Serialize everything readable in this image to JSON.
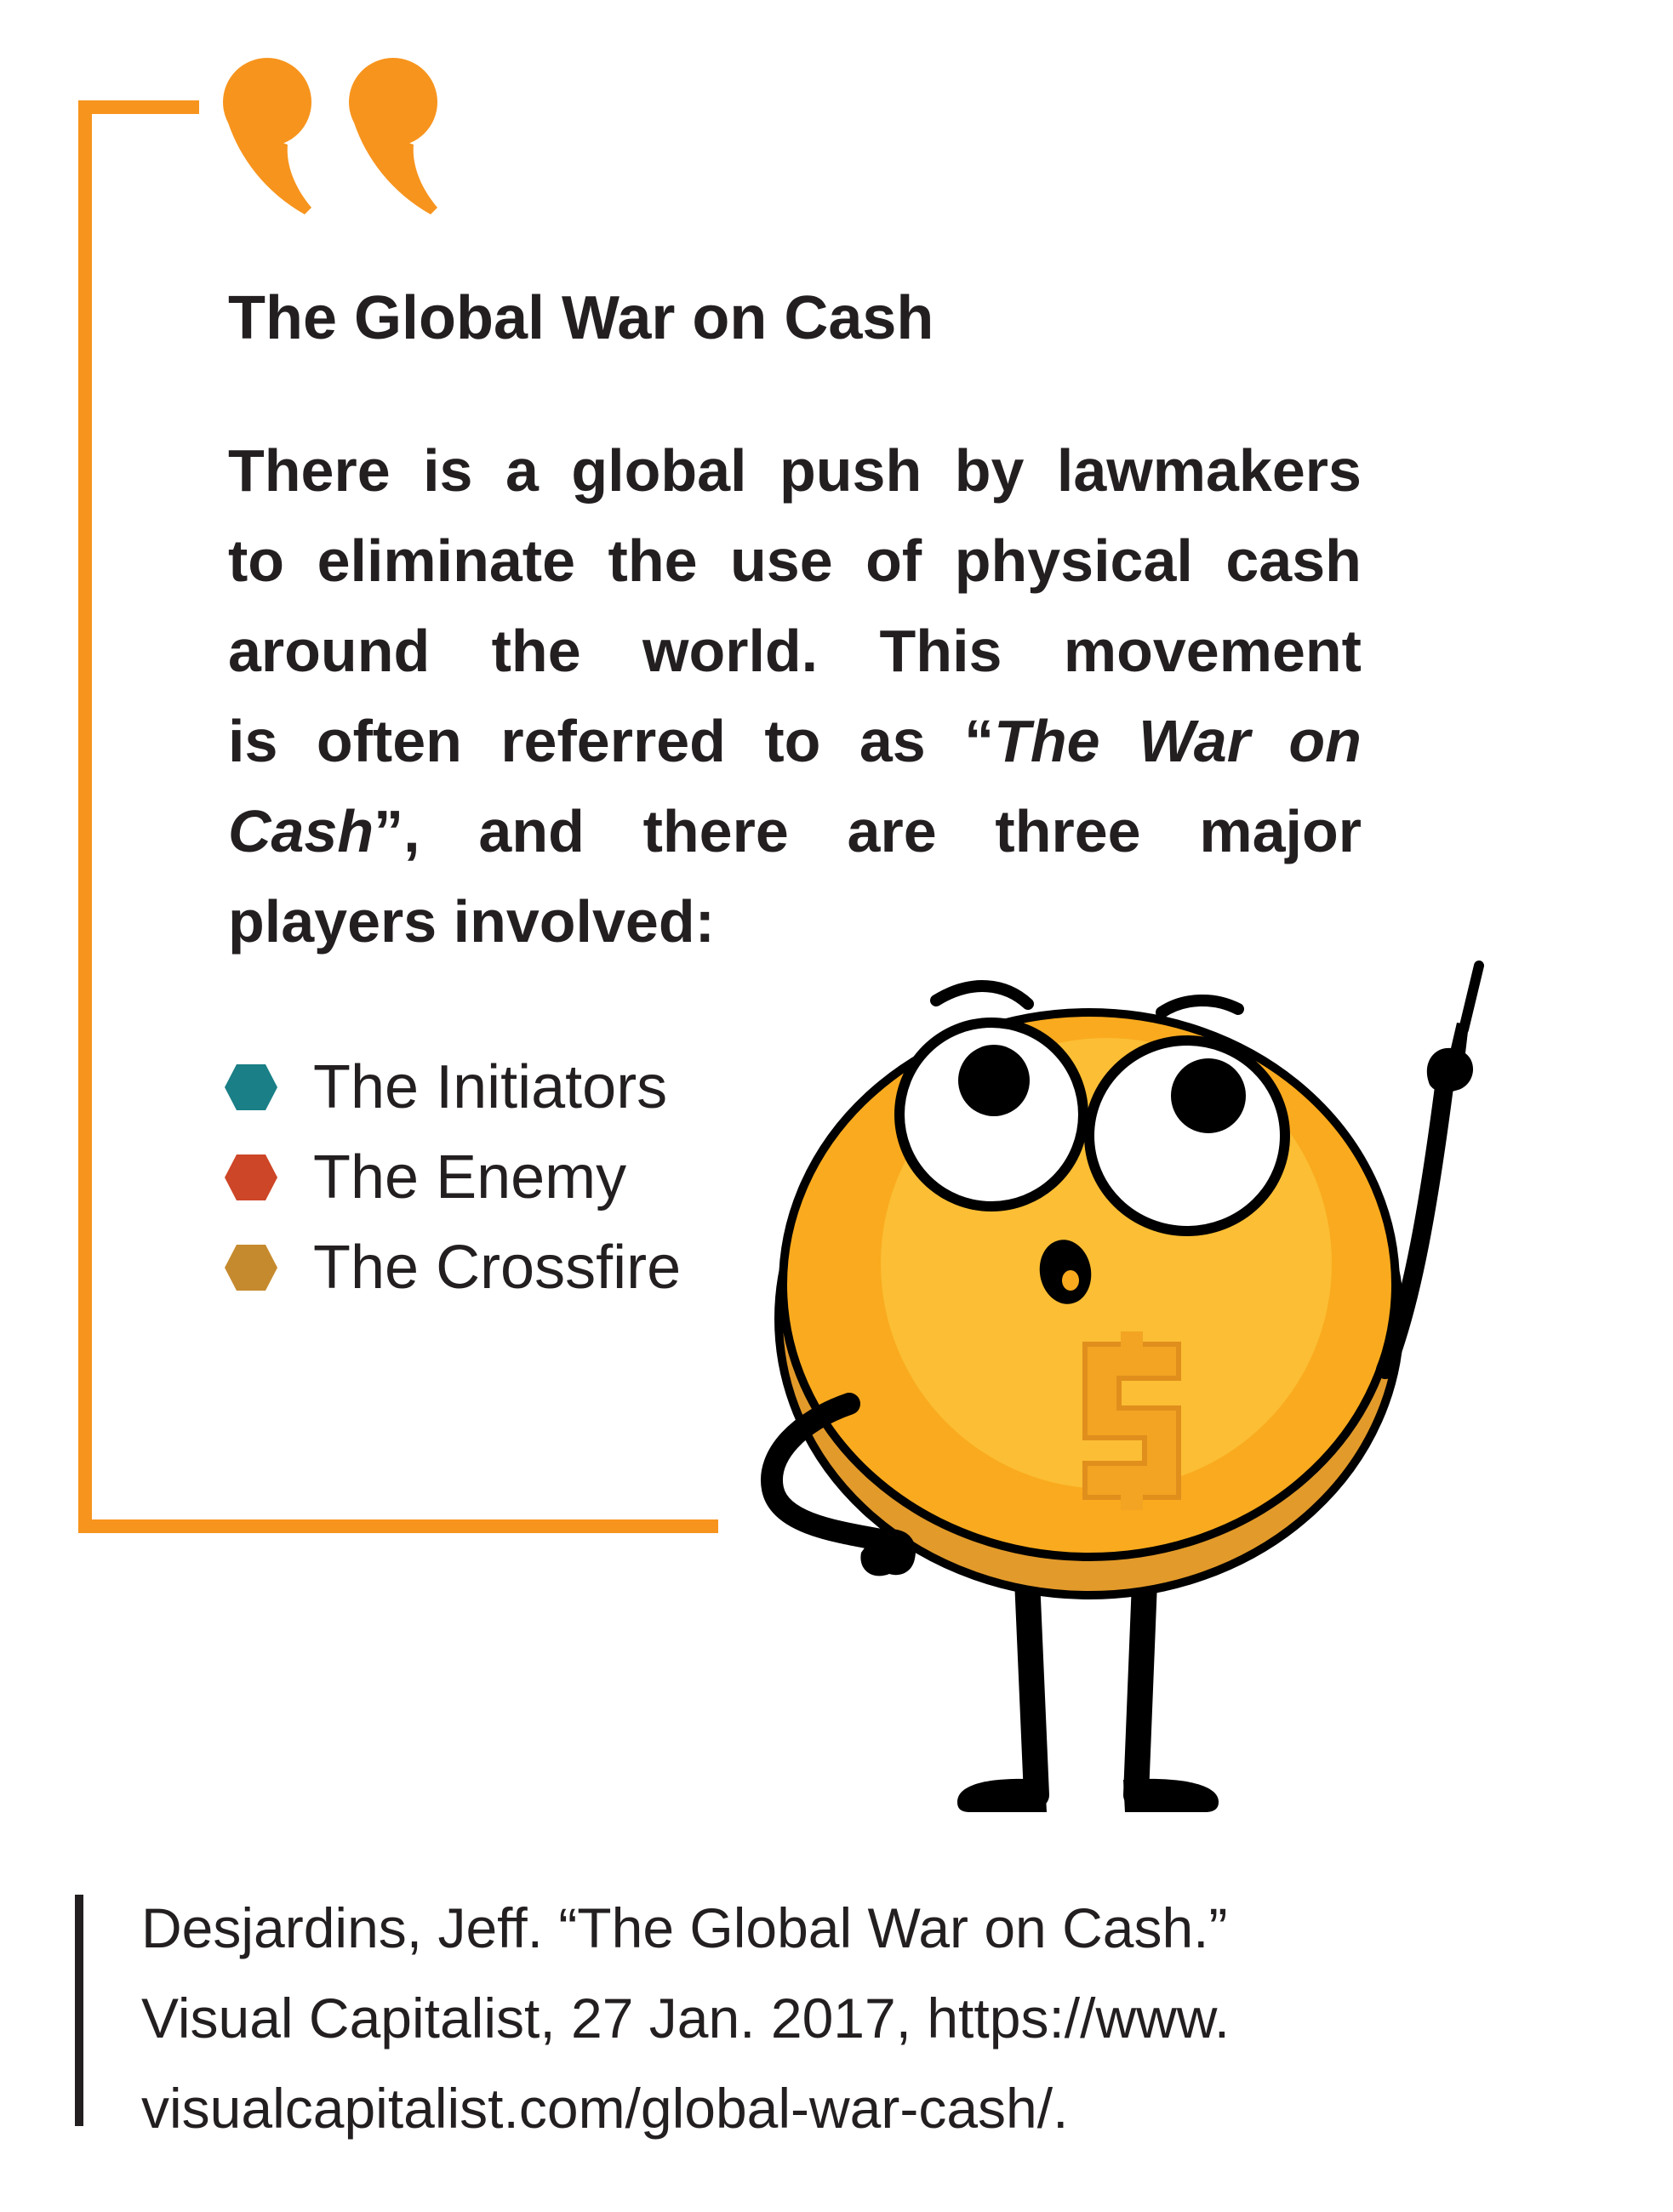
{
  "colors": {
    "accent": "#f7941d",
    "text": "#231f20",
    "initiators": "#1a7f86",
    "enemy": "#cd4627",
    "crossfire": "#c68a2e",
    "coin": "#faaa1e",
    "coin_inner": "#fbbe34",
    "coin_rim": "#e29a2a"
  },
  "icons": {
    "quote": "opening-quotation-mark-icon",
    "bullet": "hexagon-icon",
    "mascot": "coin-character-illustration"
  },
  "title": "The Global War on Cash",
  "intro": {
    "line1": [
      "There",
      "is",
      "a",
      "global",
      "push",
      "by",
      "lawmakers"
    ],
    "line2": [
      "to",
      "eliminate",
      "the",
      "use",
      "of",
      "physical",
      "cash"
    ],
    "line3": [
      "around",
      "the",
      "world.",
      "This",
      "movement"
    ],
    "line4_words": [
      "is",
      "often",
      "referred",
      "to",
      "as"
    ],
    "line4_quote_open": "“",
    "emphasis_part1": [
      "The",
      "War",
      "on"
    ],
    "emphasis_part2": "Cash",
    "line5_after": [
      "”,",
      "and",
      "there",
      "are",
      "three",
      "major"
    ],
    "line6": "players involved:"
  },
  "players": [
    {
      "label": "The Initiators",
      "color": "#1a7f86"
    },
    {
      "label": "The Enemy",
      "color": "#cd4627"
    },
    {
      "label": "The Crossfire",
      "color": "#c68a2e"
    }
  ],
  "citation": {
    "line1": "Desjardins, Jeff. “The Global War on Cash.”",
    "line2": "Visual Capitalist, 27 Jan. 2017, https://www.",
    "line3": "visualcapitalist.com/global-war-cash/."
  }
}
